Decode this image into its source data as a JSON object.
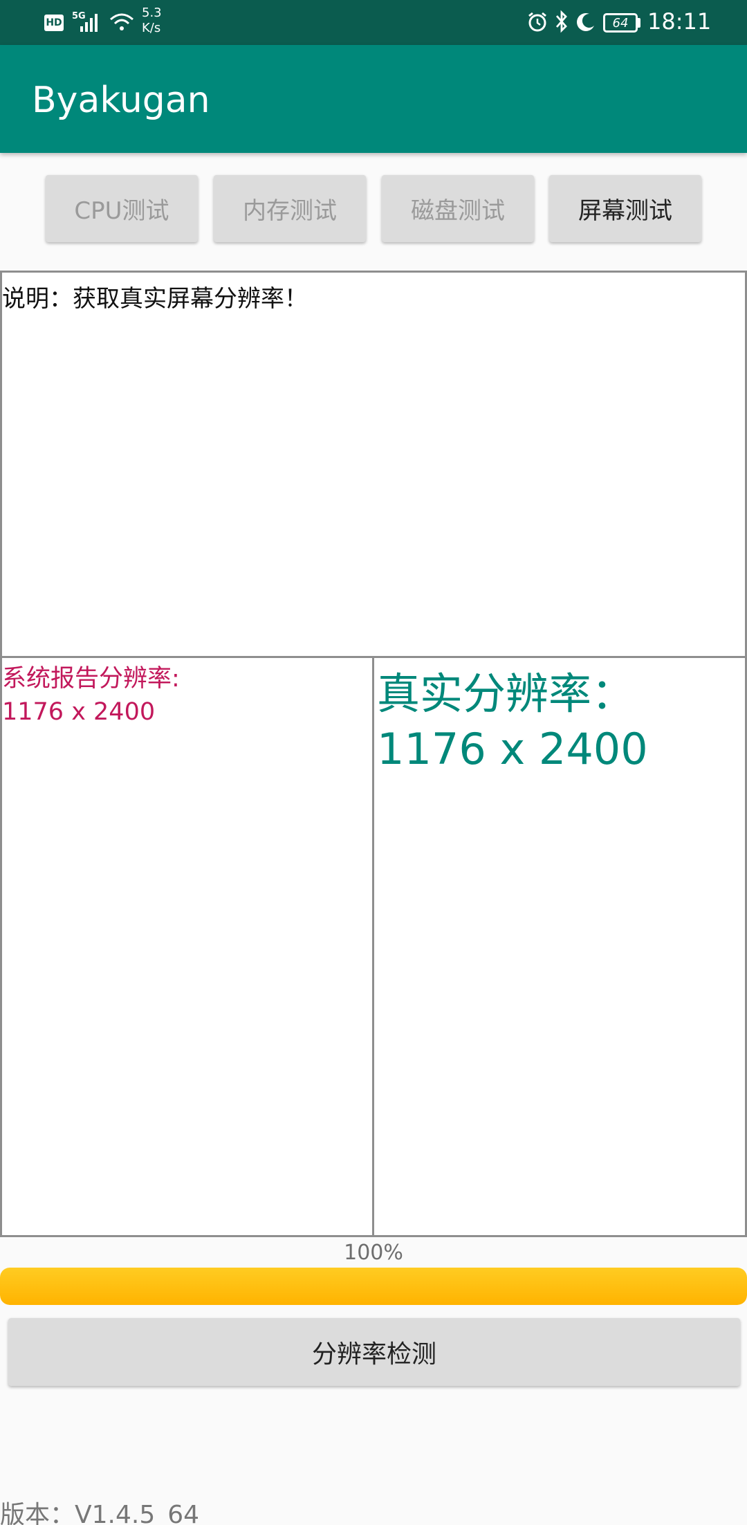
{
  "status_bar": {
    "hd": "HD",
    "network": "5G",
    "speed_value": "5.3",
    "speed_unit": "K/s",
    "battery": "64",
    "time": "18:11"
  },
  "app": {
    "title": "Byakugan"
  },
  "tabs": [
    {
      "label": "CPU测试",
      "active": false
    },
    {
      "label": "内存测试",
      "active": false
    },
    {
      "label": "磁盘测试",
      "active": false
    },
    {
      "label": "屏幕测试",
      "active": true
    }
  ],
  "description": {
    "text": "说明：获取真实屏幕分辨率！"
  },
  "system_resolution": {
    "label": "系统报告分辨率:",
    "value": "1176 x 2400"
  },
  "real_resolution": {
    "label": "真实分辨率：",
    "value": "1176 x 2400"
  },
  "progress": {
    "label": "100%",
    "percent": 100
  },
  "detect_button": {
    "label": "分辨率检测"
  },
  "version": {
    "text": "版本：V1.4.5_64"
  },
  "colors": {
    "status_bar": "#0b5c4f",
    "app_bar": "#00887a",
    "system_text": "#c2185b",
    "real_text": "#00887a",
    "progress": "#ffb300"
  },
  "icons": [
    "alarm-icon",
    "bluetooth-icon",
    "moon-icon",
    "wifi-icon",
    "signal-icon"
  ]
}
